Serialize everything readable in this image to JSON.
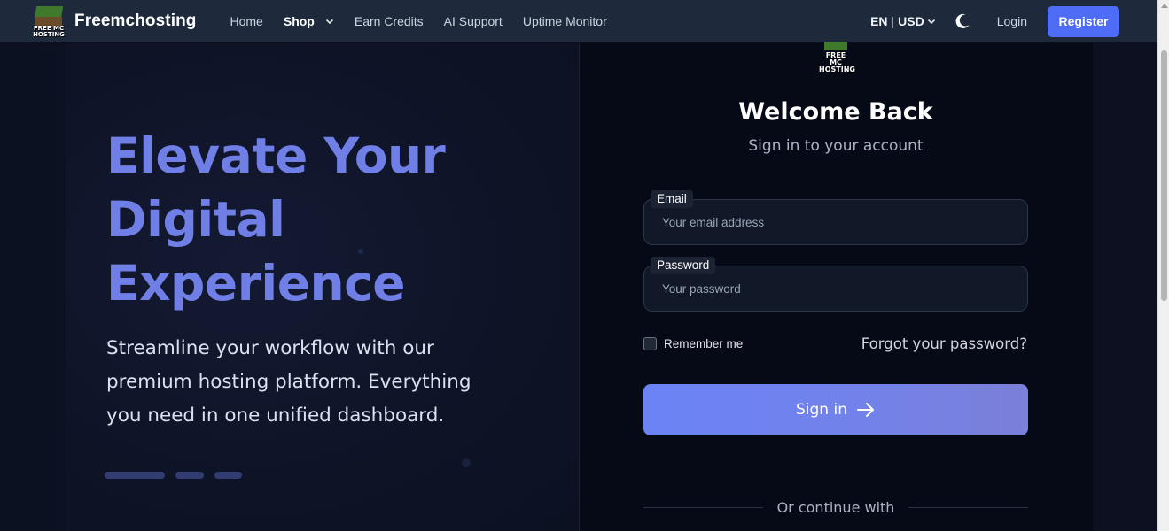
{
  "brand": {
    "name": "Freemchosting",
    "logo_text": "FREE MC HOSTING"
  },
  "nav": {
    "links": [
      {
        "label": "Home"
      },
      {
        "label": "Shop"
      },
      {
        "label": "Earn Credits"
      },
      {
        "label": "AI Support"
      },
      {
        "label": "Uptime Monitor"
      }
    ],
    "language": "EN",
    "currency": "USD",
    "login_label": "Login",
    "register_label": "Register"
  },
  "hero": {
    "title": "Elevate Your Digital Experience",
    "subtitle": "Streamline your workflow with our premium hosting platform. Everything you need in one unified dashboard."
  },
  "login": {
    "logo_text": "FREE MC HOSTING",
    "title": "Welcome Back",
    "subtitle": "Sign in to your account",
    "email_label": "Email",
    "email_placeholder": "Your email address",
    "password_label": "Password",
    "password_placeholder": "Your password",
    "remember_label": "Remember me",
    "forgot_label": "Forgot your password?",
    "submit_label": "Sign in",
    "divider_label": "Or continue with"
  },
  "colors": {
    "accent": "#4f6cf7",
    "hero_title": "#6f7fe6",
    "button_gradient_start": "#6b83f5",
    "button_gradient_end": "#7b80d8"
  },
  "icons": {
    "shop_dropdown": "chevron-down-icon",
    "currency_dropdown": "chevron-down-icon",
    "theme_toggle": "moon-icon",
    "signin_arrow": "arrow-right-icon"
  }
}
